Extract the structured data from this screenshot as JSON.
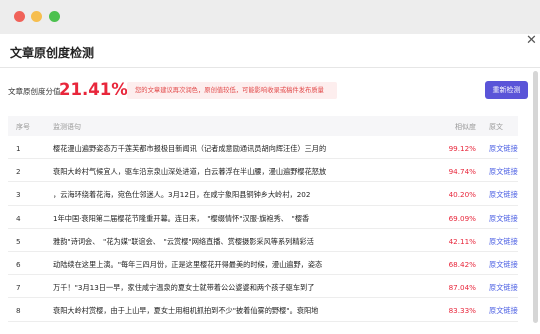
{
  "window": {
    "title": "文章原创度检测",
    "colors": {
      "close": "#f06259",
      "minimize": "#f6be4f",
      "maximize": "#4cc14f"
    }
  },
  "score": {
    "label": "文章原创度分值",
    "value": "21.41%",
    "warning": "您的文章建议再次润色，原创值较低，可能影响收录或稿件发布质量",
    "recheck_label": "重新检测"
  },
  "table": {
    "headers": {
      "no": "序号",
      "sentence": "监测语句",
      "similarity": "相似度",
      "source": "原文"
    },
    "rows": [
      {
        "no": "1",
        "sentence": "樱花漫山遍野姿态万千莲芙都市报极目新闻讯（记者成意励通讯员胡向辉汪佳）三月的",
        "similarity": "99.12%",
        "link": "原文链接"
      },
      {
        "no": "2",
        "sentence": "衰阳大岭村气候宜人，驱车沿京泉山深处进道，白云暮浮在半山腰，漫山遍野樱花怒放",
        "similarity": "94.74%",
        "link": "原文链接"
      },
      {
        "no": "3",
        "sentence": "，云海环绕着花海，宛色仕邻迷人。3月12日，在咸宁象阳县铜钟乡大岭村，202",
        "similarity": "40.20%",
        "link": "原文链接"
      },
      {
        "no": "4",
        "sentence": "1年中国·衰阳第二届樱花节隆重开幕。连日来，　\"樱缀情怀\"汉服·旗袍秀、　\"樱香",
        "similarity": "69.09%",
        "link": "原文链接"
      },
      {
        "no": "5",
        "sentence": "雅韵\"诗词会、　\"花为媒\"联谊会、　\"云赏樱\"网络直播、赏樱摄影采风等系列精彩活",
        "similarity": "42.11%",
        "link": "原文链接"
      },
      {
        "no": "6",
        "sentence": "动陆续在这里上演。\"每年三四月份，正是这里樱花开得最美的时候，漫山遍野，姿态",
        "similarity": "68.42%",
        "link": "原文链接"
      },
      {
        "no": "7",
        "sentence": "万千！\"3月13日一早，家住咸宁温泉的夏女士就带着公公婆婆和两个孩子驱车到了",
        "similarity": "87.04%",
        "link": "原文链接"
      },
      {
        "no": "8",
        "sentence": "衰阳大岭村赏樱，由于上山早，夏女士用相机抓拍到不少\"披着仙雾的野樱\"。衰阳地",
        "similarity": "83.33%",
        "link": "原文链接"
      }
    ]
  }
}
